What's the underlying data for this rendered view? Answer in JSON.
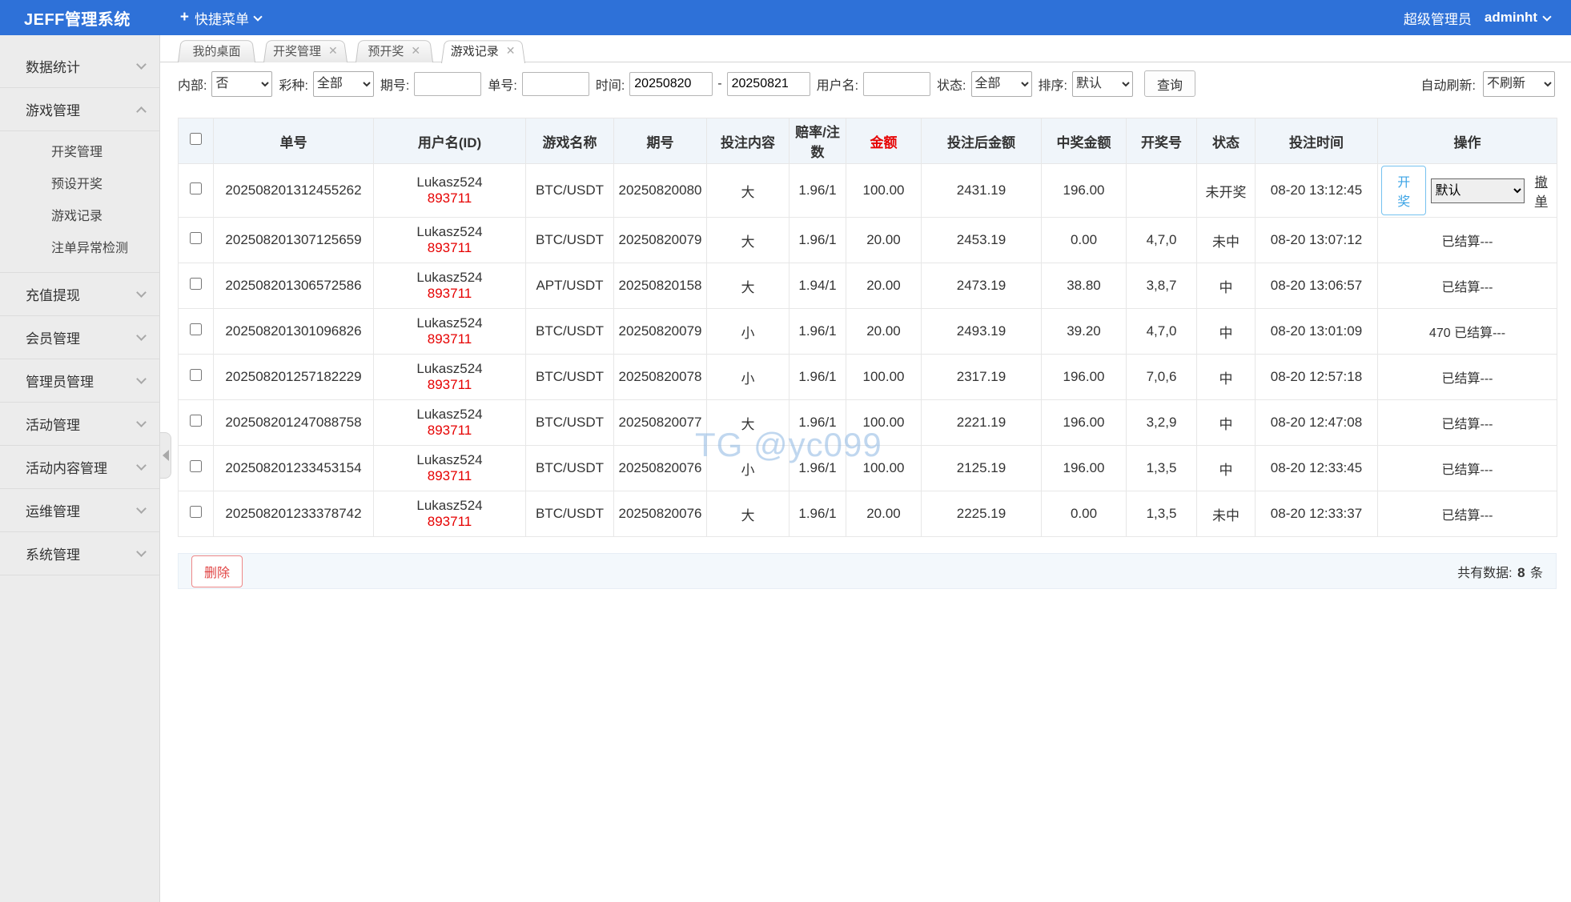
{
  "topbar": {
    "title": "JEFF管理系统",
    "quick_menu": "快捷菜单",
    "role": "超级管理员",
    "username": "adminht"
  },
  "colors": {
    "topbar_blue": "#2e71d8",
    "accent_red": "#e60000",
    "win_green": "#15a315",
    "header_bg": "#f0f5fa"
  },
  "sidebar": {
    "items": [
      {
        "label": "数据统计",
        "expanded": false,
        "children": []
      },
      {
        "label": "游戏管理",
        "expanded": true,
        "children": [
          "开奖管理",
          "预设开奖",
          "游戏记录",
          "注单异常检测"
        ]
      },
      {
        "label": "充值提现",
        "expanded": false,
        "children": []
      },
      {
        "label": "会员管理",
        "expanded": false,
        "children": []
      },
      {
        "label": "管理员管理",
        "expanded": false,
        "children": []
      },
      {
        "label": "活动管理",
        "expanded": false,
        "children": []
      },
      {
        "label": "活动内容管理",
        "expanded": false,
        "children": []
      },
      {
        "label": "运维管理",
        "expanded": false,
        "children": []
      },
      {
        "label": "系统管理",
        "expanded": false,
        "children": []
      }
    ]
  },
  "tabs": [
    {
      "label": "我的桌面",
      "closable": false,
      "active": false
    },
    {
      "label": "开奖管理",
      "closable": true,
      "active": false
    },
    {
      "label": "预开奖",
      "closable": true,
      "active": false
    },
    {
      "label": "游戏记录",
      "closable": true,
      "active": true
    }
  ],
  "filters": {
    "internal_label": "内部:",
    "internal_value": "否",
    "lottery_label": "彩种:",
    "lottery_value": "全部",
    "period_label": "期号:",
    "period_value": "",
    "order_label": "单号:",
    "order_value": "",
    "time_label": "时间:",
    "time_from": "20250820",
    "time_sep": "-",
    "time_to": "20250821",
    "user_label": "用户名:",
    "user_value": "",
    "status_label": "状态:",
    "status_value": "全部",
    "sort_label": "排序:",
    "sort_value": "默认",
    "query_label": "查询",
    "refresh_label": "自动刷新:",
    "refresh_value": "不刷新"
  },
  "table": {
    "headers": [
      {
        "label": "单号"
      },
      {
        "label": "用户名(ID)"
      },
      {
        "label": "游戏名称"
      },
      {
        "label": "期号"
      },
      {
        "label": "投注内容"
      },
      {
        "label": "赔率/注数"
      },
      {
        "label": "金额",
        "color": "#e60000"
      },
      {
        "label": "投注后金额"
      },
      {
        "label": "中奖金额"
      },
      {
        "label": "开奖号"
      },
      {
        "label": "状态"
      },
      {
        "label": "投注时间"
      },
      {
        "label": "操作"
      }
    ],
    "rows": [
      {
        "order": "202508201312455262",
        "user": "Lukasz524",
        "uid": "893711",
        "game": "BTC/USDT",
        "period": "20250820080",
        "bet": "大",
        "odds": "1.96/1",
        "amount": "100.00",
        "after_amount": "2431.19",
        "win_amount": "196.00",
        "draw": "",
        "status": "未开奖",
        "status_type": "pending",
        "time": "08-20 13:12:45",
        "action": {
          "type": "controls",
          "open_label": "开奖",
          "preset_value": "默认",
          "cancel_label": "撤单"
        }
      },
      {
        "order": "202508201307125659",
        "user": "Lukasz524",
        "uid": "893711",
        "game": "BTC/USDT",
        "period": "20250820079",
        "bet": "大",
        "odds": "1.96/1",
        "amount": "20.00",
        "after_amount": "2453.19",
        "win_amount": "0.00",
        "draw": "4,7,0",
        "status": "未中",
        "status_type": "lose",
        "time": "08-20 13:07:12",
        "action": {
          "type": "text",
          "text": "已结算---"
        }
      },
      {
        "order": "202508201306572586",
        "user": "Lukasz524",
        "uid": "893711",
        "game": "APT/USDT",
        "period": "20250820158",
        "bet": "大",
        "odds": "1.94/1",
        "amount": "20.00",
        "after_amount": "2473.19",
        "win_amount": "38.80",
        "draw": "3,8,7",
        "status": "中",
        "status_type": "win",
        "time": "08-20 13:06:57",
        "action": {
          "type": "text",
          "text": "已结算---"
        }
      },
      {
        "order": "202508201301096826",
        "user": "Lukasz524",
        "uid": "893711",
        "game": "BTC/USDT",
        "period": "20250820079",
        "bet": "小",
        "odds": "1.96/1",
        "amount": "20.00",
        "after_amount": "2493.19",
        "win_amount": "39.20",
        "draw": "4,7,0",
        "status": "中",
        "status_type": "win",
        "time": "08-20 13:01:09",
        "action": {
          "type": "text",
          "text": "470 已结算---"
        }
      },
      {
        "order": "202508201257182229",
        "user": "Lukasz524",
        "uid": "893711",
        "game": "BTC/USDT",
        "period": "20250820078",
        "bet": "小",
        "odds": "1.96/1",
        "amount": "100.00",
        "after_amount": "2317.19",
        "win_amount": "196.00",
        "draw": "7,0,6",
        "status": "中",
        "status_type": "win",
        "time": "08-20 12:57:18",
        "action": {
          "type": "text",
          "text": "已结算---"
        }
      },
      {
        "order": "202508201247088758",
        "user": "Lukasz524",
        "uid": "893711",
        "game": "BTC/USDT",
        "period": "20250820077",
        "bet": "大",
        "odds": "1.96/1",
        "amount": "100.00",
        "after_amount": "2221.19",
        "win_amount": "196.00",
        "draw": "3,2,9",
        "status": "中",
        "status_type": "win",
        "time": "08-20 12:47:08",
        "action": {
          "type": "text",
          "text": "已结算---"
        }
      },
      {
        "order": "202508201233453154",
        "user": "Lukasz524",
        "uid": "893711",
        "game": "BTC/USDT",
        "period": "20250820076",
        "bet": "小",
        "odds": "1.96/1",
        "amount": "100.00",
        "after_amount": "2125.19",
        "win_amount": "196.00",
        "draw": "1,3,5",
        "status": "中",
        "status_type": "win",
        "time": "08-20 12:33:45",
        "action": {
          "type": "text",
          "text": "已结算---"
        }
      },
      {
        "order": "202508201233378742",
        "user": "Lukasz524",
        "uid": "893711",
        "game": "BTC/USDT",
        "period": "20250820076",
        "bet": "大",
        "odds": "1.96/1",
        "amount": "20.00",
        "after_amount": "2225.19",
        "win_amount": "0.00",
        "draw": "1,3,5",
        "status": "未中",
        "status_type": "lose",
        "time": "08-20 12:33:37",
        "action": {
          "type": "text",
          "text": "已结算---"
        }
      }
    ]
  },
  "footer": {
    "delete_label": "删除",
    "total_label": "共有数据:",
    "total_count": "8",
    "total_unit": "条"
  },
  "watermark": "TG @yc099"
}
